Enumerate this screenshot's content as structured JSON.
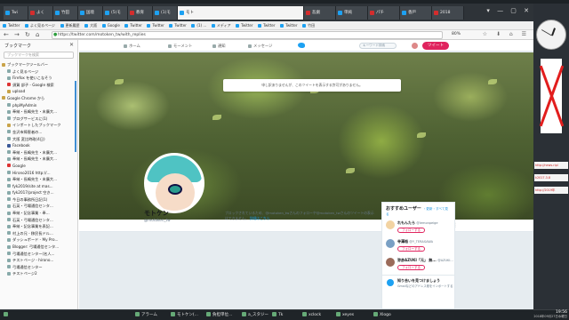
{
  "window_title": "モトケン(@motoken_tw)さん | Twitterから収集されたツイート - Mozilla Firefox",
  "tabs": [
    "Twi",
    "よく",
    "竹田",
    "国境",
    "(5)モ",
    "教育",
    "(1)モ",
    "モト",
    "悲劇",
    "単純",
    "パチ",
    "香戸",
    "2018"
  ],
  "bookmarks_toolbar": [
    "Twitter",
    "よく見るページ",
    "更新履歴",
    "大阪",
    "Google",
    "Twitter",
    "Twitter",
    "Twitter",
    "(1) ...",
    "メディア",
    "Twitter",
    "Twitter",
    "Twitter",
    "竹田"
  ],
  "url": "https://twitter.com/motoken_tw/with_replies",
  "zoom": "80%",
  "sidebar": {
    "title": "ブックマーク",
    "search_placeholder": "ブックマークを検索",
    "items": [
      "ブックマークツールバー",
      "よく見るページ",
      "Firefox を使いこなそう",
      "須賀 部子 - Google 検索",
      "upload",
      "Google Chrome から",
      "phpMyAdmin",
      "奉納・長嶋先生・末廣大...",
      "ブログサービスに(1)",
      "インポートしたブックマーク",
      "金沢市障害者の...",
      "大阪 変比時政(4日)",
      "Facebook",
      "奉納・長嶋先生・末廣大...",
      "奉納・長嶋先生・末廣大...",
      "Google",
      "Hirono2016 http://...",
      "奉納・長嶋先生・末廣大...",
      "fyk2019/site at mas...",
      "fyk2017/project 空き...",
      "今日の事務所日記(1)",
      "石英・弓場通信センタ...",
      "奉納・記念事業 - 奉...",
      "石英・弓場通信センタ...",
      "奉納・記念事業を表記...",
      "村上の兄 - 移民長ドル...",
      "ダッシュボード - My Pro...",
      "Blogger: 弓場通信センタ...",
      "弓場通信センター(名人...",
      "テストページ - hirono...",
      "弓場通信センター",
      "テストページ2"
    ]
  },
  "twitter": {
    "nav": [
      "ホーム",
      "モーメント",
      "通知",
      "メッセージ"
    ],
    "search_placeholder": "キーワード検索",
    "tweet_button": "ツイート",
    "notice": "申し訳ありませんが、このツイートを表示する許可がありません。",
    "profile_name": "モトケン",
    "profile_handle": "@motoken_tw",
    "blocked_text": "ブロックされているため、@motoken_twさんのフォローや@motoken_twさんのツイートの表示はできません。",
    "blocked_link": "詳細はこちら",
    "reco": {
      "title": "おすすめユーザー",
      "separator": "・更新・すべて見る",
      "users": [
        {
          "name": "れもんたら",
          "handle": "@lemonpeige",
          "follow": "フォローする"
        },
        {
          "name": "寺澤裕",
          "handle": "@Y_TERASAWA",
          "follow": "フォローする"
        },
        {
          "name": "弥彦AZUKI「元」 無...",
          "handle": "@AZUKI...",
          "follow": "フォローする"
        }
      ],
      "footer_title": "知り合いを見つけましょう",
      "footer_sub": "Gmailなどのアドレス帳をインポートする"
    }
  },
  "right_widgets": [
    "http://news.ripl",
    "k2017.3.8",
    "http://2019年"
  ],
  "taskbar": {
    "items": [
      "アラーム",
      "モトケン(...",
      "負担単位...",
      "a_スタジー",
      "Tk",
      "xclock",
      "xeyes",
      "Xlogo"
    ],
    "time": "19:56",
    "date": "2018年09月27日水曜日"
  }
}
